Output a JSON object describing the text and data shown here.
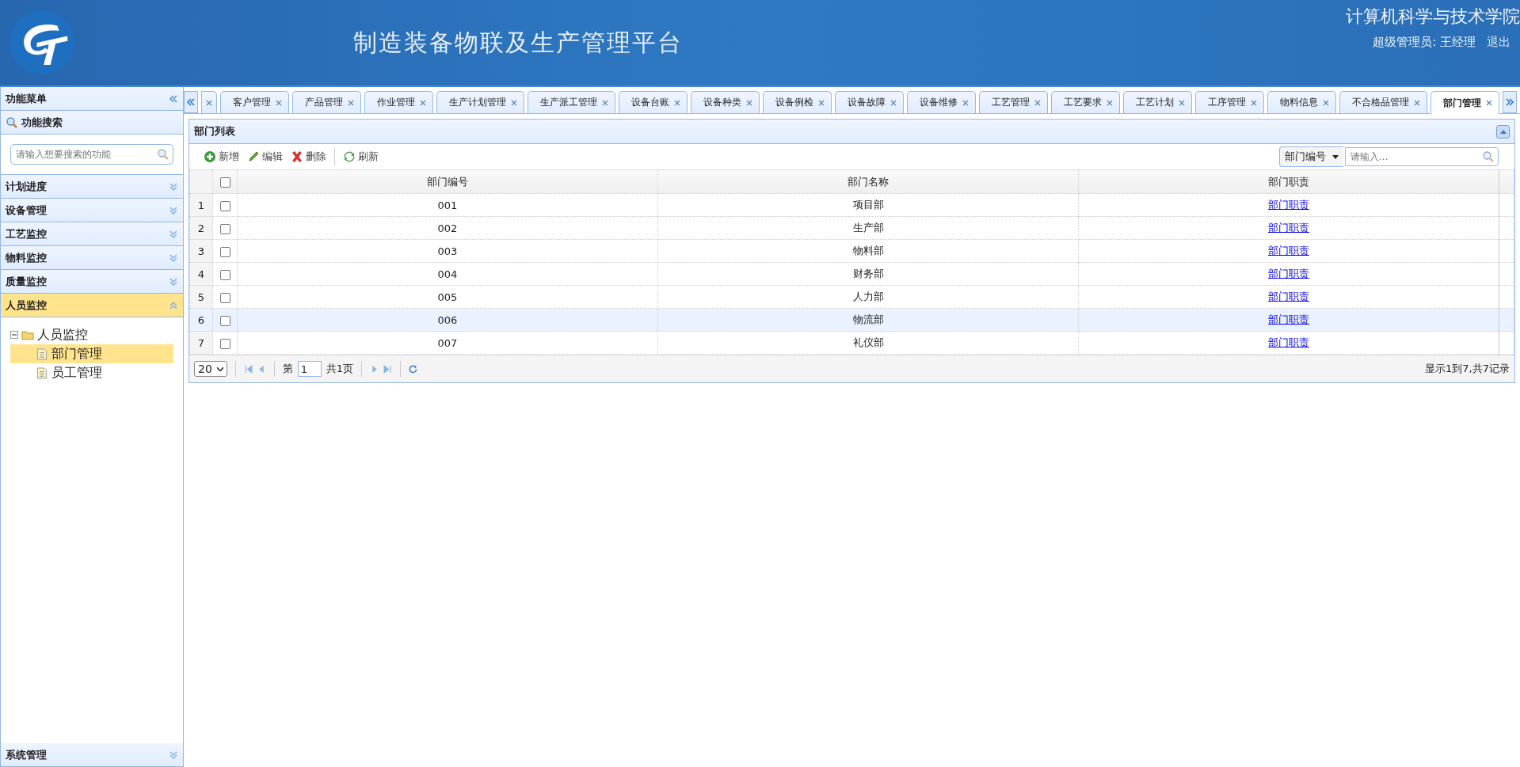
{
  "header": {
    "title": "制造装备物联及生产管理平台",
    "school": "计算机科学与技术学院",
    "user": "超级管理员: 王经理",
    "logout": "退出"
  },
  "sidebar": {
    "title": "功能菜单",
    "search_title": "功能搜索",
    "search": {
      "placeholder": "请输入想要搜索的功能"
    },
    "sections": [
      {
        "label": "计划进度",
        "expanded": false
      },
      {
        "label": "设备管理",
        "expanded": false
      },
      {
        "label": "工艺监控",
        "expanded": false
      },
      {
        "label": "物料监控",
        "expanded": false
      },
      {
        "label": "质量监控",
        "expanded": false
      },
      {
        "label": "人员监控",
        "expanded": true,
        "tree": [
          {
            "label": "人员监控",
            "expanded": true,
            "children": [
              {
                "label": "部门管理",
                "selected": true
              },
              {
                "label": "员工管理",
                "selected": false
              }
            ]
          }
        ]
      }
    ],
    "footer_section": {
      "label": "系统管理",
      "expanded": false
    }
  },
  "tabs": {
    "hidden_left": true,
    "items": [
      {
        "label": "客户管理",
        "selected": false
      },
      {
        "label": "产品管理",
        "selected": false
      },
      {
        "label": "作业管理",
        "selected": false
      },
      {
        "label": "生产计划管理",
        "selected": false
      },
      {
        "label": "生产派工管理",
        "selected": false
      },
      {
        "label": "设备台账",
        "selected": false
      },
      {
        "label": "设备种类",
        "selected": false
      },
      {
        "label": "设备例检",
        "selected": false
      },
      {
        "label": "设备故障",
        "selected": false
      },
      {
        "label": "设备维修",
        "selected": false
      },
      {
        "label": "工艺管理",
        "selected": false
      },
      {
        "label": "工艺要求",
        "selected": false
      },
      {
        "label": "工艺计划",
        "selected": false
      },
      {
        "label": "工序管理",
        "selected": false
      },
      {
        "label": "物料信息",
        "selected": false
      },
      {
        "label": "不合格品管理",
        "selected": false
      },
      {
        "label": "部门管理",
        "selected": true
      }
    ]
  },
  "panel": {
    "title": "部门列表",
    "toolbar": [
      {
        "kind": "add",
        "label": "新增"
      },
      {
        "kind": "edit",
        "label": "编辑"
      },
      {
        "kind": "delete",
        "label": "删除"
      },
      {
        "kind": "refresh",
        "label": "刷新"
      }
    ],
    "search": {
      "field": "部门编号",
      "placeholder": "请输入..."
    },
    "table": {
      "columns": [
        "部门编号",
        "部门名称",
        "部门职责"
      ],
      "rows": [
        {
          "number": "1",
          "code": "001",
          "name": "项目部",
          "duty": "部门职责",
          "checked": false,
          "selected": false
        },
        {
          "number": "2",
          "code": "002",
          "name": "生产部",
          "duty": "部门职责",
          "checked": false,
          "selected": false
        },
        {
          "number": "3",
          "code": "003",
          "name": "物料部",
          "duty": "部门职责",
          "checked": false,
          "selected": false
        },
        {
          "number": "4",
          "code": "004",
          "name": "财务部",
          "duty": "部门职责",
          "checked": false,
          "selected": false
        },
        {
          "number": "5",
          "code": "005",
          "name": "人力部",
          "duty": "部门职责",
          "checked": false,
          "selected": false
        },
        {
          "number": "6",
          "code": "006",
          "name": "物流部",
          "duty": "部门职责",
          "checked": false,
          "selected": true
        },
        {
          "number": "7",
          "code": "007",
          "name": "礼仪部",
          "duty": "部门职责",
          "checked": false,
          "selected": false
        }
      ],
      "all_checked": false
    },
    "pager": {
      "page_size": "20",
      "page_prefix": "第",
      "page": "1",
      "total_pages": "共1页",
      "summary": "显示1到7,共7记录"
    }
  }
}
